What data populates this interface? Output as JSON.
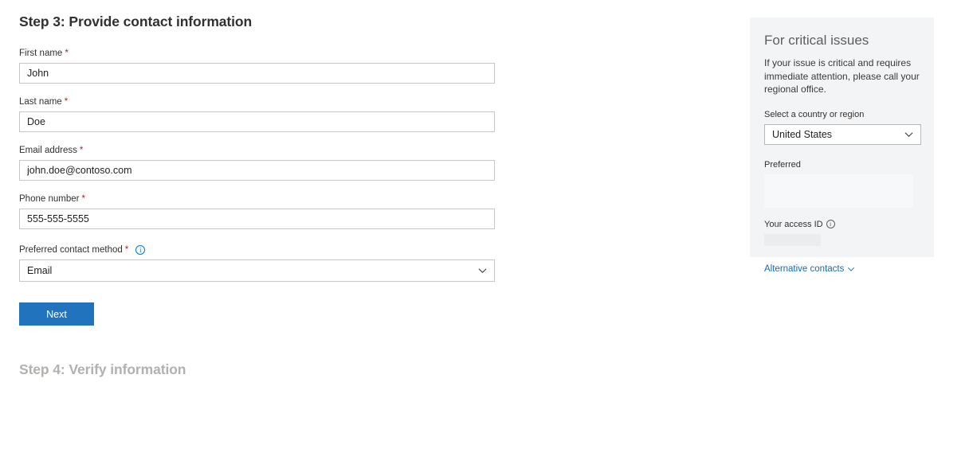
{
  "form": {
    "step_title": "Step 3: Provide contact information",
    "required_marker": "*",
    "fields": [
      {
        "label": "First name",
        "value": "John",
        "required": true,
        "type": "text"
      },
      {
        "label": "Last name",
        "value": "Doe",
        "required": true,
        "type": "text"
      },
      {
        "label": "Email address",
        "value": "john.doe@contoso.com",
        "required": true,
        "type": "text"
      },
      {
        "label": "Phone number",
        "value": "555-555-5555",
        "required": true,
        "type": "text"
      },
      {
        "label": "Preferred contact method",
        "value": "Email",
        "required": true,
        "type": "select",
        "has_info_icon": true
      }
    ],
    "next_button_label": "Next",
    "next_step_title": "Step 4: Verify information"
  },
  "side_panel": {
    "title": "For critical issues",
    "body": "If your issue is critical and requires immediate attention, please call your regional office.",
    "country_label": "Select a country or region",
    "country_value": "United States",
    "preferred_label": "Preferred",
    "access_id_label": "Your access ID",
    "alt_contacts_label": "Alternative contacts"
  },
  "icons": {
    "info": "i",
    "chevron_down": "chevron-down-icon"
  },
  "colors": {
    "accent": "#2173bd",
    "link": "#0f6cbd",
    "required": "#a4262c",
    "panel_bg": "#f3f4f6",
    "input_border": "#c8c6c4",
    "muted_title": "#b3b0ad"
  }
}
